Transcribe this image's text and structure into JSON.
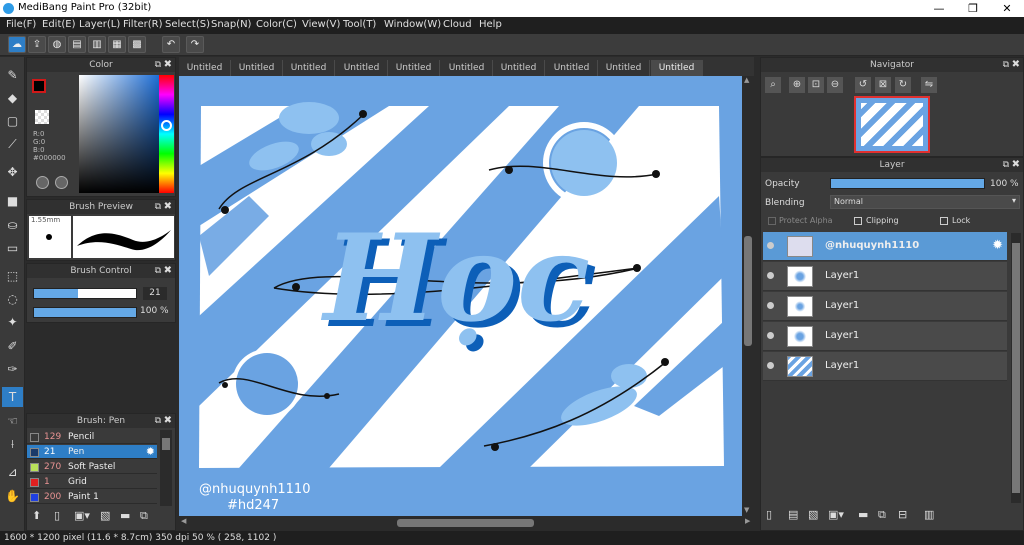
{
  "window": {
    "title": "MediBang Paint Pro (32bit)",
    "min": "—",
    "max": "❐",
    "close": "✕"
  },
  "menu": [
    "File(F)",
    "Edit(E)",
    "Layer(L)",
    "Filter(R)",
    "Select(S)",
    "Snap(N)",
    "Color(C)",
    "View(V)",
    "Tool(T)",
    "Window(W)",
    "Cloud",
    "Help"
  ],
  "toolbar_icons": [
    "cloud-icon",
    "share-icon",
    "chat-icon",
    "comment-icon",
    "page-icon",
    "pages-icon",
    "grid-icon",
    "undo-icon",
    "redo-icon"
  ],
  "color_panel": {
    "title": "Color",
    "r": "R:0",
    "g": "G:0",
    "b": "B:0",
    "hex": "#000000"
  },
  "brush_preview": {
    "title": "Brush Preview",
    "size": "1.55mm"
  },
  "brush_control": {
    "title": "Brush Control",
    "size_value": "21",
    "size_fraction": 0.43,
    "opacity_value": "100 %",
    "opacity_fraction": 1.0
  },
  "brush_list": {
    "title": "Brush: Pen",
    "items": [
      {
        "size": "129",
        "name": "Pencil",
        "color": "#3a3a3a"
      },
      {
        "size": "21",
        "name": "Pen",
        "color": "#1a3a6a",
        "selected": true
      },
      {
        "size": "270",
        "name": "Soft Pastel",
        "color": "#b8e05a"
      },
      {
        "size": "1",
        "name": "Grid",
        "color": "#e02020"
      },
      {
        "size": "200",
        "name": "Paint 1",
        "color": "#2040e0"
      }
    ]
  },
  "tabs": [
    "Untitled",
    "Untitled",
    "Untitled",
    "Untitled",
    "Untitled",
    "Untitled",
    "Untitled",
    "Untitled",
    "Untitled",
    "Untitled"
  ],
  "active_tab": 9,
  "artwork": {
    "main_text": "Học",
    "watermark_line1": "@nhuquynh1110",
    "watermark_line2": "#hd247"
  },
  "navigator": {
    "title": "Navigator"
  },
  "layer_panel": {
    "title": "Layer",
    "opacity_label": "Opacity",
    "opacity_value": "100 %",
    "opacity_fraction": 1.0,
    "blending_label": "Blending",
    "blending_value": "Normal",
    "protect_alpha": "Protect Alpha",
    "clipping": "Clipping",
    "lock": "Lock",
    "layers": [
      {
        "name": "@nhuquynh1110",
        "selected": true
      },
      {
        "name": "Layer1"
      },
      {
        "name": "Layer1"
      },
      {
        "name": "Layer1"
      },
      {
        "name": "Layer1"
      }
    ]
  },
  "status": "1600 * 1200 pixel   (11.6 * 8.7cm)  350 dpi   50 %   ( 258, 1102 )",
  "colors": {
    "accent": "#2e7ec6",
    "canvas_blue": "#6aa3e2",
    "light_blue": "#8ec1f0"
  }
}
